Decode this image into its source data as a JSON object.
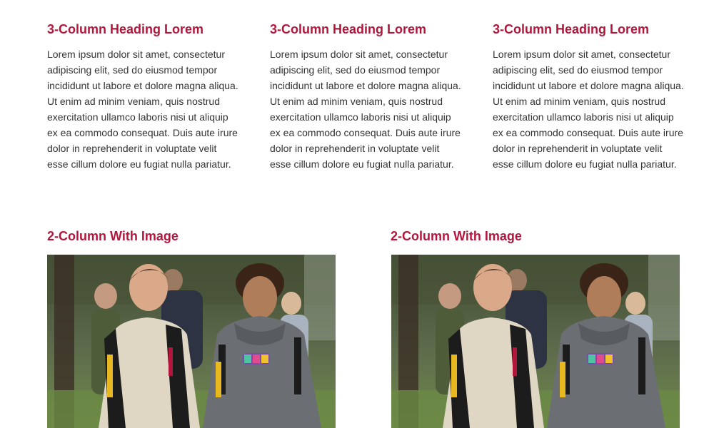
{
  "three_column": [
    {
      "heading": "3-Column Heading Lorem",
      "body": "Lorem ipsum dolor sit amet, consectetur adipiscing elit, sed do eiusmod tempor incididunt ut labore et dolore magna aliqua. Ut enim ad minim veniam, quis nostrud exercitation ullamco laboris nisi ut aliquip ex ea commodo consequat. Duis aute irure dolor in reprehenderit in voluptate velit esse cillum dolore eu fugiat nulla pariatur."
    },
    {
      "heading": "3-Column Heading Lorem",
      "body": "Lorem ipsum dolor sit amet, consectetur adipiscing elit, sed do eiusmod tempor incididunt ut labore et dolore magna aliqua. Ut enim ad minim veniam, quis nostrud exercitation ullamco laboris nisi ut aliquip ex ea commodo consequat. Duis aute irure dolor in reprehenderit in voluptate velit esse cillum dolore eu fugiat nulla pariatur."
    },
    {
      "heading": "3-Column Heading Lorem",
      "body": "Lorem ipsum dolor sit amet, consectetur adipiscing elit, sed do eiusmod tempor incididunt ut labore et dolore magna aliqua. Ut enim ad minim veniam, quis nostrud exercitation ullamco laboris nisi ut aliquip ex ea commodo consequat. Duis aute irure dolor in reprehenderit in voluptate velit esse cillum dolore eu fugiat nulla pariatur."
    }
  ],
  "two_column": [
    {
      "heading": "2-Column With Image"
    },
    {
      "heading": "2-Column With Image"
    }
  ],
  "colors": {
    "heading": "#b3163c",
    "body_text": "#333333"
  }
}
